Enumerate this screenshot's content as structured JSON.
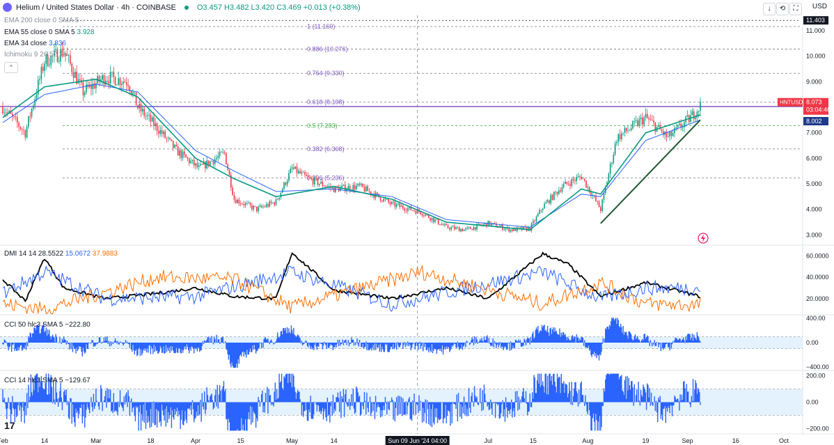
{
  "header": {
    "title": "Helium / United States Dollar · 4h · COINBASE",
    "ohlc": "O3.457 H3.482 L3.420 C3.469 +0.013 (+0.38%)",
    "currency": "USD"
  },
  "legend": {
    "ema200": "EMA 200 close 0 SMA 5",
    "ema55": "EMA 55 close 0 SMA 5",
    "ema55_val": "3.928",
    "ema34": "EMA 34 close",
    "ema34_val": "3.836",
    "ichimoku": "Ichimoku 9 26 52 26",
    "dmi": "DMI 14 14",
    "dmi_adx": "28.5522",
    "dmi_plus": "15.0672",
    "dmi_minus": "37.9883",
    "cci50": "CCI 50 hlc3 SMA 5",
    "cci50_val": "−222.80",
    "cci14": "CCI 14 hlc3 SMA 5",
    "cci14_val": "−129.67"
  },
  "toolbar": {
    "down": "↓",
    "expand": "⟲",
    "fullscreen": "⛶"
  },
  "colors": {
    "up": "#089981",
    "down": "#f23645",
    "ema34": "#089981",
    "ema55": "#2962ff",
    "fib": "#787b86",
    "hline": "#7e57c2",
    "trend": "#1e5631",
    "adx": "#000000",
    "diplus": "#2962ff",
    "diminus": "#ff6d00",
    "cci": "#2962ff",
    "band": "#e3f2fd"
  },
  "chart_data": [
    {
      "type": "candlestick",
      "symbol": "HNTUSD",
      "y_ticks": [
        "11.000",
        "10.000",
        "9.000",
        "8.000",
        "7.000",
        "6.000",
        "5.000",
        "4.000",
        "3.000"
      ],
      "ylim": [
        2.6,
        11.6
      ],
      "x_ticks": [
        "Feb",
        "14",
        "Mar",
        "18",
        "Apr",
        "15",
        "May",
        "14",
        "Jul",
        "15",
        "Aug",
        "19",
        "Sep",
        "16",
        "Oct"
      ],
      "crosshair_label": "Sun 09 Jun '24  04:00",
      "price_tags": {
        "high_line": "11.403",
        "symbol": "HNTUSD",
        "last": "8.073",
        "countdown": "03:04:46",
        "ema": "8.002"
      },
      "fib_levels": [
        {
          "label": "1 (11.160)",
          "value": 11.16
        },
        {
          "label": "0.886 (10.276)",
          "value": 10.276
        },
        {
          "label": "0.764 (9.330)",
          "value": 9.33
        },
        {
          "label": "0.618 (8.198)",
          "value": 8.198
        },
        {
          "label": "0.5 (7.283)",
          "value": 7.283
        },
        {
          "label": "0.382 (6.368)",
          "value": 6.368
        },
        {
          "label": "0.236 (5.236)",
          "value": 5.236
        }
      ],
      "horizontal_line": 8.0,
      "trendline": [
        [
          "Aug 5",
          3.45
        ],
        [
          "Sep 5",
          7.5
        ]
      ],
      "close_anchors": [
        [
          "Feb 1",
          8.0
        ],
        [
          "Feb 8",
          7.0
        ],
        [
          "Feb 14",
          9.8
        ],
        [
          "Feb 20",
          10.2
        ],
        [
          "Feb 26",
          8.6
        ],
        [
          "Mar 4",
          9.2
        ],
        [
          "Mar 11",
          9.0
        ],
        [
          "Mar 14",
          8.0
        ],
        [
          "Mar 20",
          7.2
        ],
        [
          "Mar 26",
          6.3
        ],
        [
          "Apr 2",
          5.6
        ],
        [
          "Apr 10",
          6.2
        ],
        [
          "Apr 13",
          4.4
        ],
        [
          "Apr 20",
          4.0
        ],
        [
          "Apr 26",
          4.3
        ],
        [
          "May 1",
          5.6
        ],
        [
          "May 6",
          5.2
        ],
        [
          "May 14",
          4.8
        ],
        [
          "May 22",
          4.9
        ],
        [
          "Jun 1",
          4.2
        ],
        [
          "Jun 10",
          3.9
        ],
        [
          "Jun 18",
          3.3
        ],
        [
          "Jun 24",
          3.2
        ],
        [
          "Jul 1",
          3.45
        ],
        [
          "Jul 8",
          3.2
        ],
        [
          "Jul 14",
          3.25
        ],
        [
          "Jul 18",
          4.1
        ],
        [
          "Jul 24",
          4.9
        ],
        [
          "Jul 30",
          5.3
        ],
        [
          "Aug 5",
          4.0
        ],
        [
          "Aug 10",
          6.8
        ],
        [
          "Aug 19",
          7.6
        ],
        [
          "Aug 26",
          6.8
        ],
        [
          "Sep 2",
          7.6
        ],
        [
          "Sep 5",
          8.07
        ]
      ],
      "ema34_anchors": [
        [
          "Feb 1",
          7.6
        ],
        [
          "Feb 14",
          8.8
        ],
        [
          "Mar 1",
          9.1
        ],
        [
          "Mar 14",
          8.4
        ],
        [
          "Apr 1",
          6.0
        ],
        [
          "Apr 13",
          5.2
        ],
        [
          "Apr 26",
          4.5
        ],
        [
          "May 14",
          4.9
        ],
        [
          "Jun 1",
          4.4
        ],
        [
          "Jun 18",
          3.5
        ],
        [
          "Jul 14",
          3.2
        ],
        [
          "Jul 30",
          4.8
        ],
        [
          "Aug 5",
          4.6
        ],
        [
          "Aug 19",
          7.0
        ],
        [
          "Sep 5",
          7.7
        ]
      ],
      "ema55_anchors": [
        [
          "Feb 1",
          7.4
        ],
        [
          "Feb 14",
          8.5
        ],
        [
          "Mar 1",
          8.9
        ],
        [
          "Mar 14",
          8.6
        ],
        [
          "Apr 1",
          6.3
        ],
        [
          "Apr 13",
          5.5
        ],
        [
          "Apr 26",
          4.7
        ],
        [
          "May 14",
          4.8
        ],
        [
          "Jun 1",
          4.5
        ],
        [
          "Jun 18",
          3.6
        ],
        [
          "Jul 14",
          3.3
        ],
        [
          "Jul 30",
          4.6
        ],
        [
          "Aug 5",
          4.5
        ],
        [
          "Aug 19",
          6.7
        ],
        [
          "Sep 5",
          7.5
        ]
      ]
    },
    {
      "type": "line",
      "name": "DMI 14 14",
      "y_ticks": [
        "60.0000",
        "40.0000",
        "20.0000"
      ],
      "ylim": [
        5,
        70
      ],
      "series": [
        {
          "name": "ADX",
          "anchors": [
            [
              "Feb 1",
              38
            ],
            [
              "Feb 8",
              18
            ],
            [
              "Feb 14",
              58
            ],
            [
              "Feb 20",
              30
            ],
            [
              "Mar 4",
              20
            ],
            [
              "Mar 20",
              25
            ],
            [
              "Apr 1",
              30
            ],
            [
              "Apr 13",
              22
            ],
            [
              "Apr 26",
              20
            ],
            [
              "May 1",
              63
            ],
            [
              "May 14",
              28
            ],
            [
              "Jun 1",
              20
            ],
            [
              "Jun 18",
              30
            ],
            [
              "Jul 1",
              20
            ],
            [
              "Jul 18",
              62
            ],
            [
              "Jul 26",
              52
            ],
            [
              "Aug 5",
              22
            ],
            [
              "Aug 19",
              35
            ],
            [
              "Sep 5",
              22
            ]
          ]
        },
        {
          "name": "+DI",
          "anchors": [
            [
              "Feb 1",
              25
            ],
            [
              "Feb 14",
              45
            ],
            [
              "Mar 4",
              20
            ],
            [
              "Apr 1",
              22
            ],
            [
              "May 1",
              45
            ],
            [
              "Jun 1",
              15
            ],
            [
              "Jul 18",
              45
            ],
            [
              "Aug 5",
              20
            ],
            [
              "Aug 19",
              30
            ],
            [
              "Sep 5",
              30
            ]
          ]
        },
        {
          "name": "−DI",
          "anchors": [
            [
              "Feb 1",
              15
            ],
            [
              "Feb 14",
              10
            ],
            [
              "Mar 20",
              40
            ],
            [
              "Apr 13",
              38
            ],
            [
              "May 1",
              12
            ],
            [
              "Jun 10",
              45
            ],
            [
              "Jul 18",
              15
            ],
            [
              "Aug 5",
              35
            ],
            [
              "Aug 19",
              15
            ],
            [
              "Sep 5",
              14
            ]
          ]
        }
      ]
    },
    {
      "type": "bar",
      "name": "CCI 50 hlc3 SMA 5",
      "y_ticks": [
        "400.00",
        "0.00",
        "−400.00"
      ],
      "ylim": [
        -460,
        460
      ],
      "band": [
        -100,
        100
      ]
    },
    {
      "type": "bar",
      "name": "CCI 14 hlc3 SMA 5",
      "y_ticks": [
        "200.00",
        "0.00",
        "−200.00"
      ],
      "ylim": [
        -240,
        240
      ],
      "band": [
        -100,
        100
      ]
    }
  ]
}
